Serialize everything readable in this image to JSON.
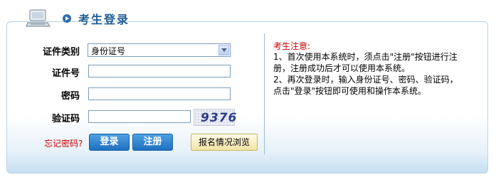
{
  "header": {
    "title": "考生登录"
  },
  "form": {
    "id_type_label": "证件类别",
    "id_type_selected": "身份证号",
    "id_number_label": "证件号",
    "id_number_value": "",
    "password_label": "密码",
    "password_value": "",
    "captcha_label": "验证码",
    "captcha_value": "",
    "captcha_image_text": "9376"
  },
  "actions": {
    "forgot_label": "忘记密码?",
    "login_label": "登录",
    "register_label": "注册",
    "browse_label": "报名情况浏览"
  },
  "notice": {
    "title": "考生注意:",
    "lines": [
      "1、首次使用本系统时，须点击\"注册\"按钮进行注",
      "册，注册成功后才可以使用本系统。",
      "2、再次登录时，输入身份证号、密码、验证码，",
      "点击\"登录\"按钮即可使用和操作本系统。"
    ]
  },
  "colors": {
    "title": "#1f5d93",
    "notice_title": "#cc0000",
    "forgot": "#cc0000",
    "button_blue": "#1f6fbf",
    "panel_border": "#b9d3e6"
  }
}
